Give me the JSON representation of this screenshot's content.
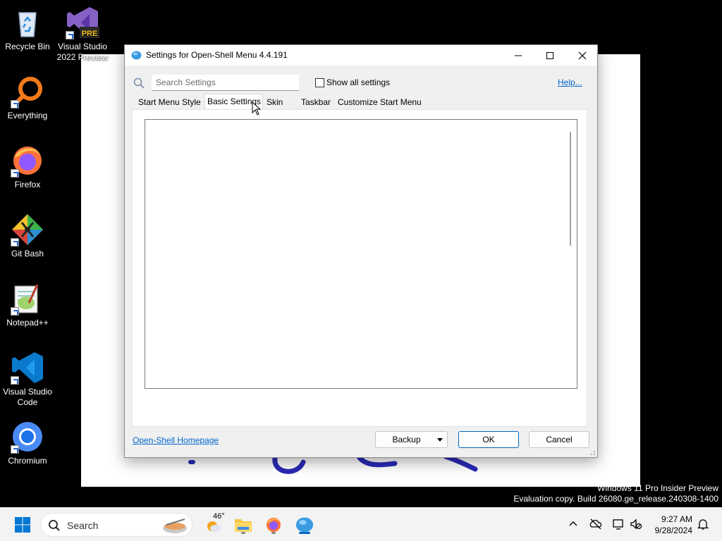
{
  "desktop": {
    "icons": [
      {
        "label": "Recycle Bin"
      },
      {
        "label": "Visual Studio 2022 Preview",
        "badge": "PRE"
      },
      {
        "label": "Everything"
      },
      {
        "label": "Firefox"
      },
      {
        "label": "Git Bash"
      },
      {
        "label": "Notepad++"
      },
      {
        "label": "Visual Studio Code"
      },
      {
        "label": "Chromium"
      }
    ],
    "watermark_line1": "Windows 11 Pro Insider Preview",
    "watermark_line2": "Evaluation copy. Build 26080.ge_release.240308-1400"
  },
  "dialog": {
    "title": "Settings for Open-Shell Menu 4.4.191",
    "search_placeholder": "Search Settings",
    "show_all_label": "Show all settings",
    "show_all_checked": false,
    "help_label": "Help...",
    "tabs": [
      {
        "label": "Start Menu Style",
        "active": false
      },
      {
        "label": "Basic Settings",
        "active": true
      },
      {
        "label": "Skin",
        "active": false
      },
      {
        "label": "Taskbar",
        "active": false
      },
      {
        "label": "Customize Start Menu",
        "active": false
      }
    ],
    "homepage_label": "Open-Shell Homepage",
    "backup_label": "Backup",
    "ok_label": "OK",
    "cancel_label": "Cancel"
  },
  "taskbar": {
    "search_label": "Search",
    "weather_temp": "46°",
    "time": "9:27 AM",
    "date": "9/28/2024"
  },
  "colors": {
    "accent": "#0067c0",
    "link": "#0066cc"
  }
}
